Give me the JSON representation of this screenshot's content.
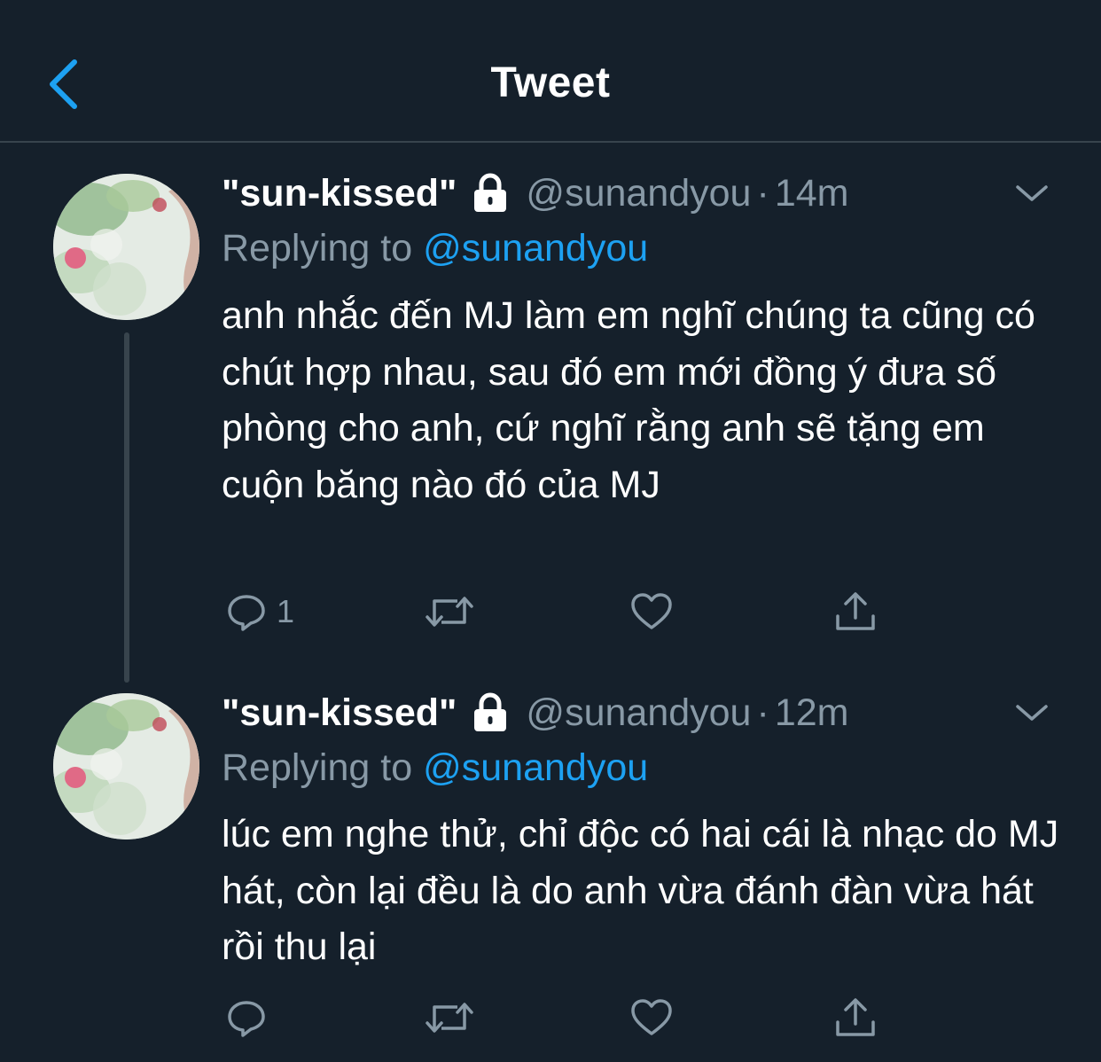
{
  "header": {
    "title": "Tweet",
    "accent_color": "#1da1f2",
    "back_icon": "chevron-left-icon"
  },
  "tweets": [
    {
      "display_name": "\"sun-kissed\"",
      "locked_icon": "lock-icon",
      "handle": "@sunandyou",
      "separator": "·",
      "time": "14m",
      "replying_label": "Replying to",
      "replying_to": "@sunandyou",
      "text": "anh nhắc đến MJ làm em nghĩ chúng ta cũng có chút hợp nhau, sau đó em mới đồng ý đưa số phòng cho anh, cứ nghĩ rằng anh sẽ tặng em cuộn băng nào đó của MJ",
      "reply_count": "1"
    },
    {
      "display_name": "\"sun-kissed\"",
      "locked_icon": "lock-icon",
      "handle": "@sunandyou",
      "separator": "·",
      "time": "12m",
      "replying_label": "Replying to",
      "replying_to": "@sunandyou",
      "text": "lúc em nghe thử, chỉ độc có hai cái là nhạc do MJ hát, còn lại đều là do anh vừa đánh đàn vừa hát rồi thu lại",
      "reply_count": ""
    }
  ],
  "colors": {
    "background": "#15202b",
    "secondary_text": "#8899a6",
    "divider": "#38444d"
  }
}
